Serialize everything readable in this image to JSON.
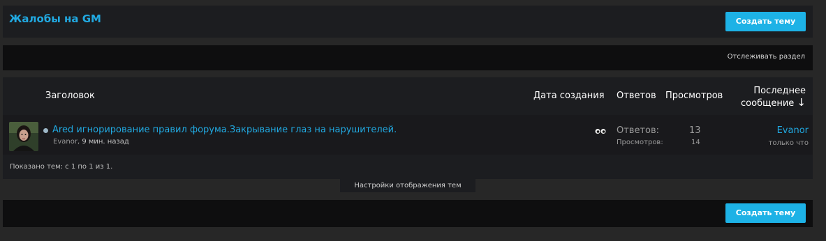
{
  "forum": {
    "title": "Жалобы на GM",
    "create_button": "Создать тему"
  },
  "watch": {
    "label": "Отслеживать раздел"
  },
  "columns": {
    "title": "Заголовок",
    "created": "Дата создания",
    "replies": "Ответов",
    "views": "Просмотров",
    "last_line1": "Последнее",
    "last_line2": "сообщение",
    "sort_arrow": "↓"
  },
  "topics": [
    {
      "title": "Ared игнорирование правил форума.Закрывание глаз на нарушителей.",
      "author": "Evanor",
      "separator": ",",
      "time": "9 мин. назад",
      "icon": "eyes-icon",
      "replies_label": "Ответов:",
      "replies": "13",
      "views_label": "Просмотров:",
      "views": "14",
      "last_user": "Evanor",
      "last_time": "только что"
    }
  ],
  "footer": {
    "shown": "Показано тем: с 1 по 1 из 1.",
    "display_settings": "Настройки отображения тем",
    "create_button": "Создать тему"
  },
  "colors": {
    "accent": "#21a9e1",
    "button": "#1db2e6",
    "background": "#272727"
  }
}
